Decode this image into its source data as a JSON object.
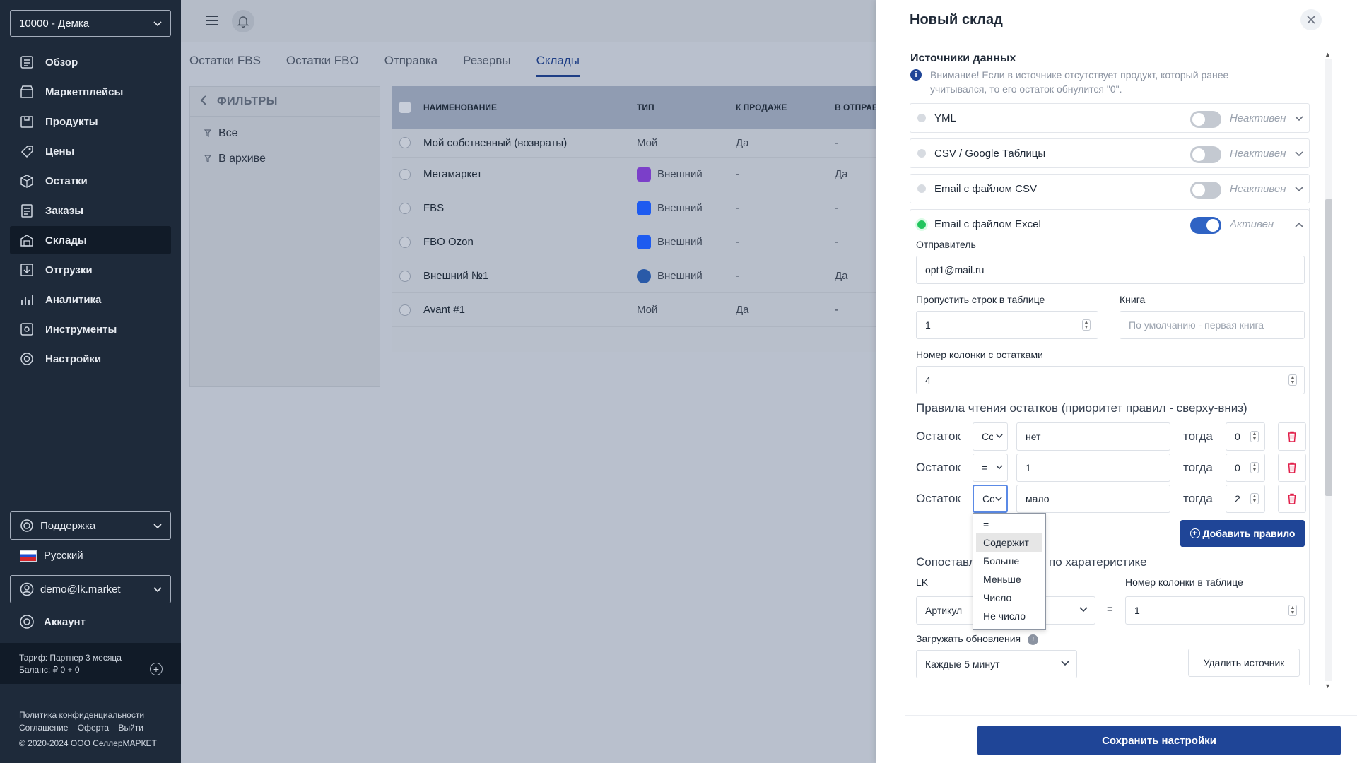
{
  "sidebar": {
    "account_select": "10000 - Демка",
    "nav": [
      {
        "label": "Обзор",
        "icon": "overview-icon"
      },
      {
        "label": "Маркетплейсы",
        "icon": "marketplaces-icon"
      },
      {
        "label": "Продукты",
        "icon": "products-icon"
      },
      {
        "label": "Цены",
        "icon": "prices-icon"
      },
      {
        "label": "Остатки",
        "icon": "stock-icon"
      },
      {
        "label": "Заказы",
        "icon": "orders-icon"
      },
      {
        "label": "Склады",
        "icon": "warehouses-icon",
        "active": true
      },
      {
        "label": "Отгрузки",
        "icon": "shipments-icon"
      },
      {
        "label": "Аналитика",
        "icon": "analytics-icon"
      },
      {
        "label": "Инструменты",
        "icon": "tools-icon"
      },
      {
        "label": "Настройки",
        "icon": "settings-icon"
      }
    ],
    "support": "Поддержка",
    "language": "Русский",
    "user": "demo@lk.market",
    "account": "Аккаунт",
    "tariff": "Тариф: Партнер 3 месяца",
    "balance": "Баланс: ₽ 0 + 0",
    "links": {
      "privacy": "Политика конфиденциальности",
      "agreement": "Соглашение",
      "offer": "Оферта",
      "logout": "Выйти"
    },
    "copyright": "© 2020-2024 ООО СеллерМАРКЕТ"
  },
  "tabs": [
    "Остатки FBS",
    "Остатки FBO",
    "Отправка",
    "Резервы",
    "Склады"
  ],
  "active_tab": "Склады",
  "filters": {
    "title": "ФИЛЬТРЫ",
    "items": [
      "Все",
      "В архиве"
    ]
  },
  "table": {
    "columns": [
      "НАИМЕНОВАНИЕ",
      "ТИП",
      "К ПРОДАЖЕ",
      "В ОТПРАВК"
    ],
    "rows": [
      {
        "name": "Мой собственный (возвраты)",
        "type": "Мой",
        "logo": "",
        "sale": "Да",
        "ship": "-"
      },
      {
        "name": "Мегамаркет",
        "type": "Внешний",
        "logo": "megamarket",
        "sale": "-",
        "ship": "Да"
      },
      {
        "name": "FBS",
        "type": "Внешний",
        "logo": "ozon",
        "sale": "-",
        "ship": "-"
      },
      {
        "name": "FBO Ozon",
        "type": "Внешний",
        "logo": "ozon",
        "sale": "-",
        "ship": "-"
      },
      {
        "name": "Внешний №1",
        "type": "Внешний",
        "logo": "external",
        "sale": "-",
        "ship": "Да"
      },
      {
        "name": "Avant #1",
        "type": "Мой",
        "logo": "",
        "sale": "Да",
        "ship": "-"
      }
    ]
  },
  "drawer": {
    "title": "Новый склад",
    "section_title": "Источники данных",
    "notice": "Внимание! Если в источнике отсутствует продукт, который ранее учитывался, то его остаток обнулится \"0\".",
    "sources": [
      {
        "name": "YML",
        "status": "Неактивен",
        "active": false
      },
      {
        "name": "CSV / Google Таблицы",
        "status": "Неактивен",
        "active": false
      },
      {
        "name": "Email с файлом CSV",
        "status": "Неактивен",
        "active": false
      },
      {
        "name": "Email с файлом Excel",
        "status": "Активен",
        "active": true
      }
    ],
    "sender_label": "Отправитель",
    "sender_value": "opt1@mail.ru",
    "skip_label": "Пропустить строк в таблице",
    "skip_value": "1",
    "book_label": "Книга",
    "book_placeholder": "По умолчанию - первая книга",
    "stock_col_label": "Номер колонки с остатками",
    "stock_col_value": "4",
    "rules_title": "Правила чтения остатков (приоритет правил - сверху-вниз)",
    "rules": [
      {
        "label": "Остаток",
        "op": "Содержит",
        "value": "нет",
        "then": "тогда",
        "result": "0"
      },
      {
        "label": "Остаток",
        "op": "=",
        "value": "1",
        "then": "тогда",
        "result": "0"
      },
      {
        "label": "Остаток",
        "op": "Содержит",
        "value": "мало",
        "then": "тогда",
        "result": "2"
      }
    ],
    "add_rule": "Добавить правило",
    "operator_options": [
      "=",
      "Содержит",
      "Больше",
      "Меньше",
      "Число",
      "Не число"
    ],
    "operator_selected": "Содержит",
    "mapping_title_left": "Сопоставл",
    "mapping_title_right": "по харатеристике",
    "lk_label": "LK",
    "lk_value": "Артикул",
    "equals": "=",
    "col_label": "Номер колонки в таблице",
    "col_value": "1",
    "updates_label": "Загружать обновления",
    "updates_value": "Каждые 5 минут",
    "delete_source": "Удалить источник",
    "save": "Сохранить настройки"
  },
  "colors": {
    "sidebar": "#1e2a3a",
    "primary": "#1f4597",
    "active_dot": "#22c55e",
    "trash": "#e11d48"
  }
}
